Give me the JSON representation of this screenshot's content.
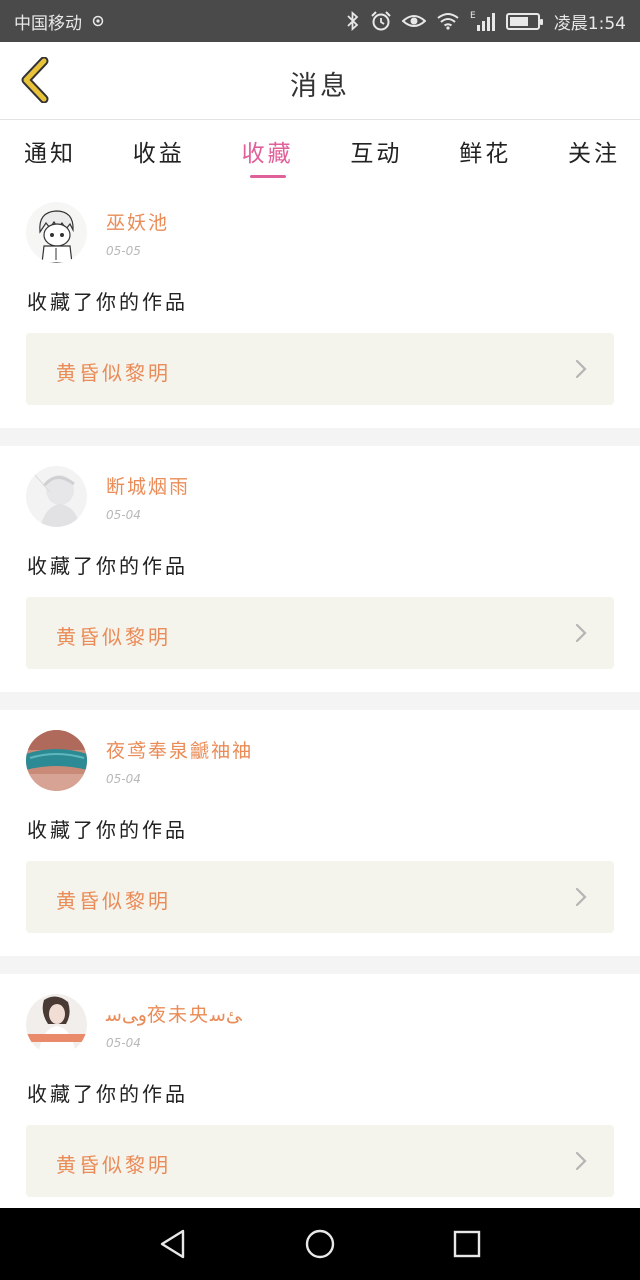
{
  "status_bar": {
    "carrier": "中国移动",
    "time": "凌晨1:54",
    "network_type": "E",
    "icons": [
      "sim-icon",
      "bluetooth-icon",
      "alarm-icon",
      "eye-icon",
      "wifi-icon",
      "signal-icon",
      "battery-icon"
    ]
  },
  "header": {
    "title": "消息",
    "back_icon": "chevron-left-icon",
    "back_color": "#e8c23a"
  },
  "tabs": {
    "items": [
      {
        "label": "通知",
        "active": false
      },
      {
        "label": "收益",
        "active": false
      },
      {
        "label": "收藏",
        "active": true
      },
      {
        "label": "互动",
        "active": false
      },
      {
        "label": "鲜花",
        "active": false
      },
      {
        "label": "关注",
        "active": false
      }
    ],
    "active_color": "#e0609a"
  },
  "feed": {
    "items": [
      {
        "username": "巫妖池",
        "date": "05-05",
        "action": "收藏了你的作品",
        "work_title": "黄昏似黎明",
        "avatar": "sketch-boy-avatar"
      },
      {
        "username": "断城烟雨",
        "date": "05-04",
        "action": "收藏了你的作品",
        "work_title": "黄昏似黎明",
        "avatar": "pale-figure-avatar"
      },
      {
        "username": "夜鸢奉泉䶵䄂䄂",
        "date": "05-04",
        "action": "收藏了你的作品",
        "work_title": "黄昏似黎明",
        "avatar": "teal-cloth-avatar"
      },
      {
        "username": "ﻭﯽﺳ夜未央ﺊﺳ",
        "date": "05-04",
        "action": "收藏了你的作品",
        "work_title": "黄昏似黎明",
        "avatar": "girl-portrait-avatar"
      }
    ],
    "accent_color": "#ea8c58",
    "card_bg": "#f4f3ec"
  },
  "navbar": {
    "icons": [
      "back-triangle-icon",
      "home-circle-icon",
      "recents-square-icon"
    ]
  }
}
